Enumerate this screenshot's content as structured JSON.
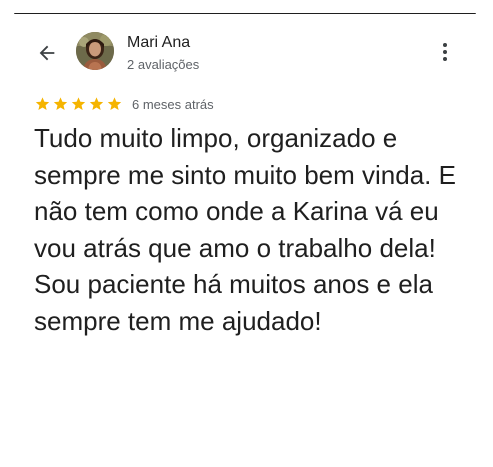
{
  "review": {
    "author": {
      "name": "Mari Ana",
      "meta": "2 avaliações",
      "avatar_icon": "profile-photo"
    },
    "rating": {
      "stars": 5,
      "max": 5,
      "color": "#F5B400"
    },
    "date": "6 meses atrás",
    "text": "Tudo muito limpo, organizado e sempre me sinto muito bem vinda. E não tem como onde a Karina vá eu vou atrás que amo o trabalho dela! Sou paciente há muitos anos e ela sempre tem me ajudado!"
  },
  "header": {
    "back_icon": "arrow-left-icon",
    "more_icon": "more-vertical-icon"
  }
}
